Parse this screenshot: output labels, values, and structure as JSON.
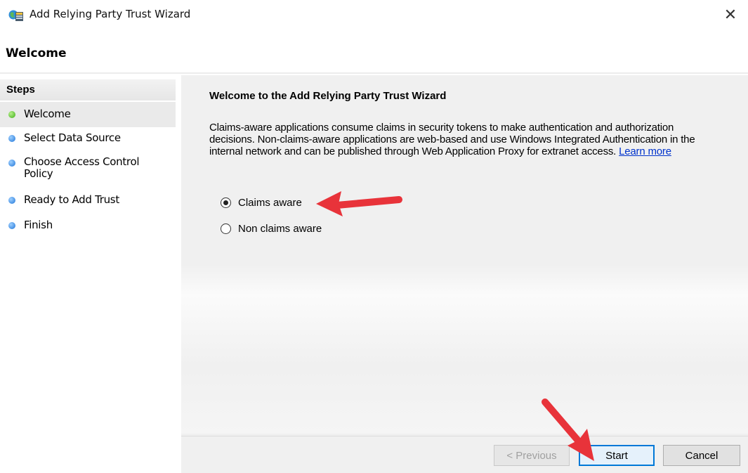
{
  "window": {
    "title": "Add Relying Party Trust Wizard",
    "close_glyph": "✕"
  },
  "page_heading": "Welcome",
  "steps": {
    "header": "Steps",
    "items": [
      {
        "label": "Welcome",
        "status": "current",
        "color": "#3fae16"
      },
      {
        "label": "Select Data Source",
        "status": "pending",
        "color": "#1d74d8"
      },
      {
        "label": "Choose Access Control Policy",
        "status": "pending",
        "color": "#1d74d8"
      },
      {
        "label": "Ready to Add Trust",
        "status": "pending",
        "color": "#1d74d8"
      },
      {
        "label": "Finish",
        "status": "pending",
        "color": "#1d74d8"
      }
    ]
  },
  "content": {
    "title": "Welcome to the Add Relying Party Trust Wizard",
    "description": "Claims-aware applications consume claims in security tokens to make authentication and authorization decisions. Non-claims-aware applications are web-based and use Windows Integrated Authentication in the internal network and can be published through Web Application Proxy for extranet access.",
    "learn_more": "Learn more",
    "options": [
      {
        "label": "Claims aware",
        "selected": true
      },
      {
        "label": "Non claims aware",
        "selected": false
      }
    ]
  },
  "buttons": {
    "previous": "< Previous",
    "start": "Start",
    "cancel": "Cancel"
  },
  "annotations": {
    "arrow_color": "#e8333a"
  }
}
